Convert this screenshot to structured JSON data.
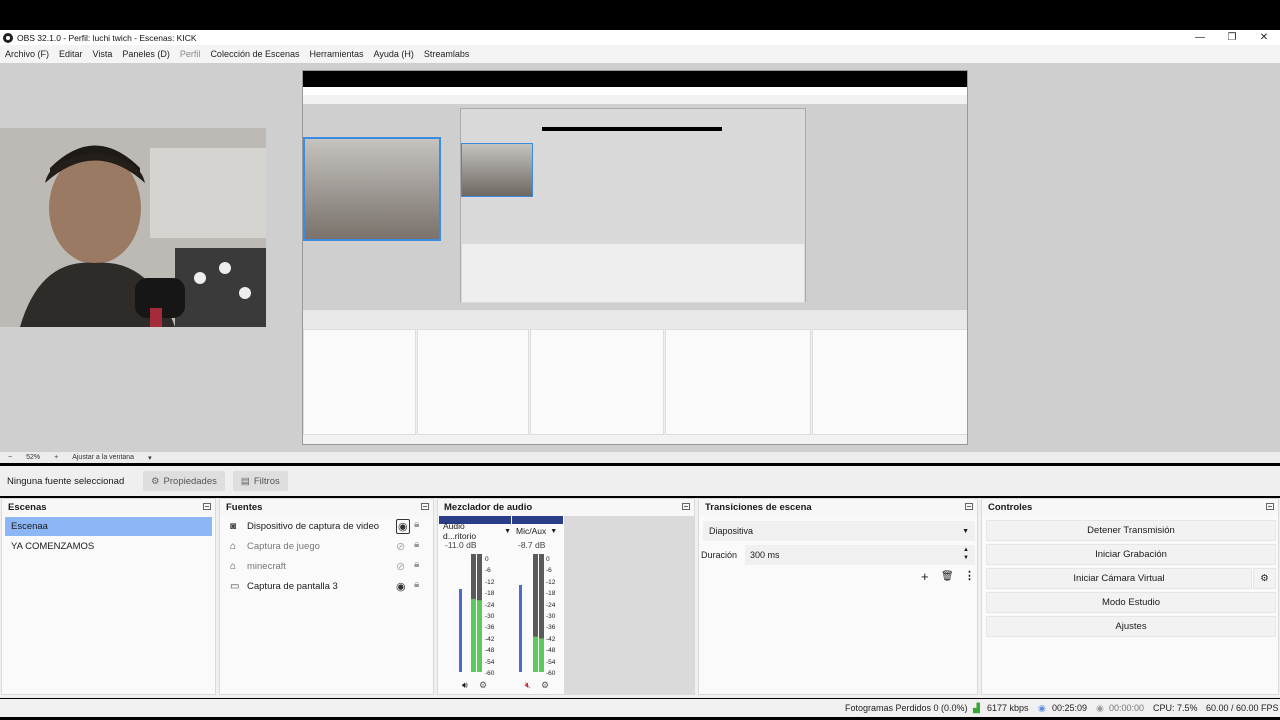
{
  "window": {
    "title": "OBS 32.1.0 - Perfil: luchi twich - Escenas: KICK",
    "minimize": "—",
    "maximize": "❐",
    "close": "✕"
  },
  "menu": [
    "Archivo (F)",
    "Editar",
    "Vista",
    "Paneles (D)",
    "Perfil",
    "Colección de Escenas",
    "Herramientas",
    "Ayuda (H)",
    "Streamlabs"
  ],
  "zoom": {
    "value": "52%",
    "plus": "+",
    "minus": "−",
    "fit": "Ajustar a la ventana",
    "dropdown": "▾"
  },
  "source_toolbar": {
    "no_selection": "Ninguna fuente seleccionad",
    "properties": "Propiedades",
    "filters": "Filtros"
  },
  "scenes": {
    "title": "Escenas",
    "items": [
      "Escenaa",
      "YA COMENZAMOS"
    ],
    "selected_index": 0
  },
  "sources": {
    "title": "Fuentes",
    "items": [
      {
        "label": "Dispositivo de captura de video",
        "icon": "camera-icon",
        "visible": true
      },
      {
        "label": "Captura de juego",
        "icon": "gamepad-icon",
        "visible": false
      },
      {
        "label": "minecraft",
        "icon": "gamepad-icon",
        "visible": false
      },
      {
        "label": "Captura de pantalla 3",
        "icon": "monitor-icon",
        "visible": true
      }
    ]
  },
  "mixer": {
    "title": "Mezclador de audio",
    "channels": [
      {
        "name": "Audio d...ritorio",
        "db": "-11.0 dB",
        "level": 0.62,
        "fader": 0.7,
        "muted": false
      },
      {
        "name": "Mic/Aux",
        "db": "-8.7 dB",
        "level": 0.3,
        "fader": 0.74,
        "muted": true
      }
    ],
    "scale": [
      "0",
      "-6",
      "-12",
      "-18",
      "-24",
      "-30",
      "-36",
      "-42",
      "-48",
      "-54",
      "-60"
    ]
  },
  "transitions": {
    "title": "Transiciones de escena",
    "type": "Diapositiva",
    "duration_label": "Duración",
    "duration_value": "300 ms"
  },
  "controls": {
    "title": "Controles",
    "buttons": [
      "Detener Transmisión",
      "Iniciar Grabación",
      "Iniciar Cámara Virtual",
      "Modo Estudio",
      "Ajustes"
    ]
  },
  "status": {
    "dropped": "Fotogramas Perdidos 0 (0.0%)",
    "bitrate": "6177 kbps",
    "stream_time": "00:25:09",
    "rec_time": "00:00:00",
    "cpu": "CPU: 7.5%",
    "fps": "60.00 / 60.00 FPS"
  },
  "colors": {
    "selection": "#8db6f5",
    "meter_green": "#5cc95c",
    "meter_yellow": "#e4d04c",
    "meter_red": "#c94444",
    "header_blue": "#2a3d86"
  }
}
